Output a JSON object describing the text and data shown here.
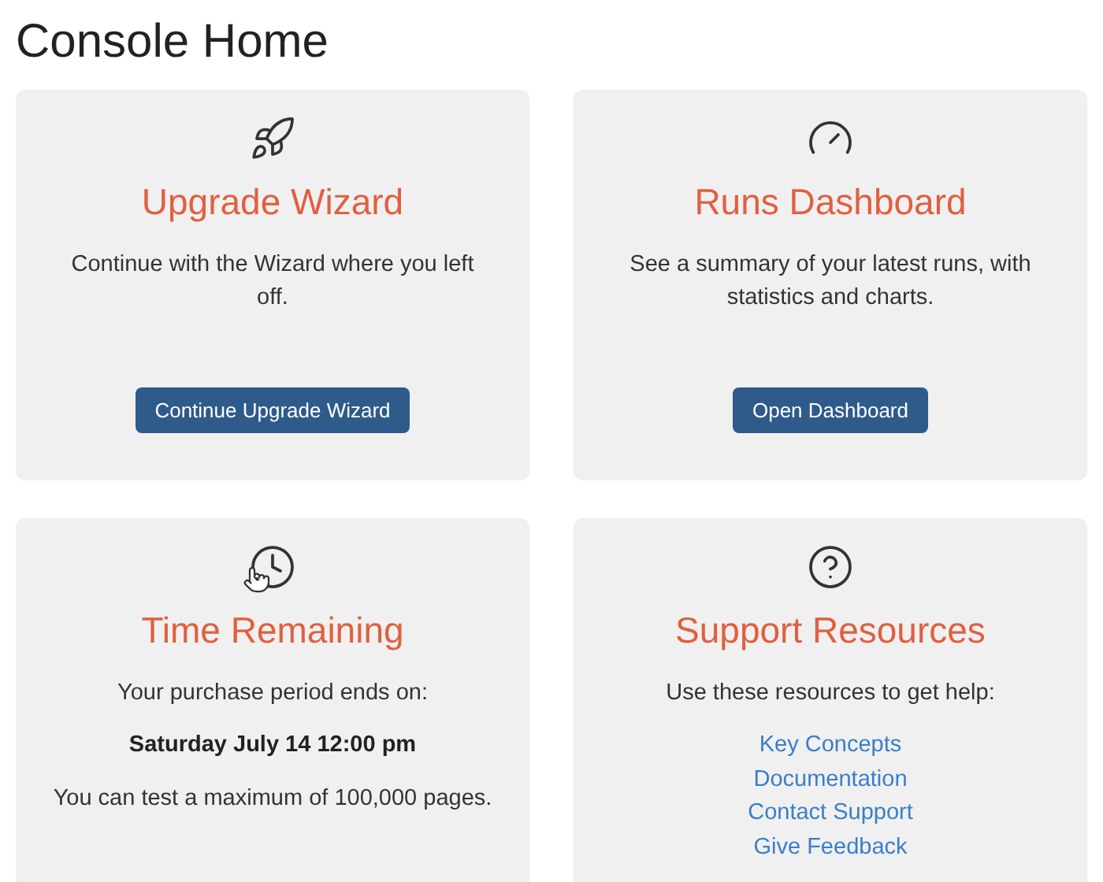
{
  "page_title": "Console Home",
  "cards": [
    {
      "kind": "action",
      "title": "Upgrade Wizard",
      "description": "Continue with the Wizard where you left off.",
      "button": "Continue Upgrade Wizard"
    },
    {
      "kind": "action",
      "title": "Runs Dashboard",
      "description": "See a summary of your latest runs, with statistics and charts.",
      "button": "Open Dashboard"
    },
    {
      "kind": "info",
      "title": "Time Remaining",
      "lines": [
        {
          "text": "Your purchase period ends on:",
          "bold": false
        },
        {
          "text": "Saturday July 14 12:00 pm",
          "bold": true
        },
        {
          "text": "You can test a maximum of 100,000 pages.",
          "bold": false
        }
      ]
    },
    {
      "kind": "links",
      "title": "Support Resources",
      "description": "Use these resources to get help:",
      "links": [
        "Key Concepts",
        "Documentation",
        "Contact Support",
        "Give Feedback"
      ]
    }
  ]
}
